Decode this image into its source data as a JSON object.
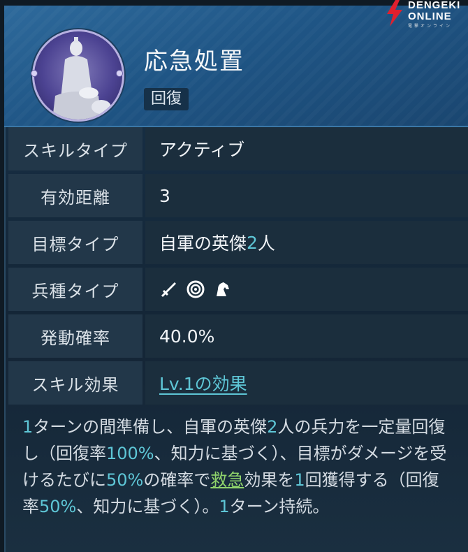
{
  "logo": {
    "text_top": "DENGEKI",
    "text_bottom": "ONLINE",
    "sub": "電撃オンライン"
  },
  "skill": {
    "name": "応急処置",
    "category": "回復"
  },
  "rows": {
    "skill_type": {
      "label": "スキルタイプ",
      "value": "アクティブ"
    },
    "range": {
      "label": "有効距離",
      "value": "3"
    },
    "target": {
      "label": "目標タイプ",
      "value_prefix": "自軍の英傑",
      "value_num": "2",
      "value_suffix": "人"
    },
    "unit_type": {
      "label": "兵種タイプ",
      "icons": [
        "sword-icon",
        "bow-target-icon",
        "cavalry-horse-icon"
      ]
    },
    "trigger_rate": {
      "label": "発動確率",
      "value": "40.0%"
    },
    "skill_effect": {
      "label": "スキル効果",
      "value": "Lv.1の効果"
    }
  },
  "description": {
    "p1": "1",
    "p2": "ターンの間準備し、自軍の英傑",
    "p3": "2",
    "p4": "人の兵力を一定量回復し（回復率",
    "p5": "100%",
    "p6": "、知力に基づく）、目標がダメージを受けるたびに",
    "p7": "50%",
    "p8": "の確率で",
    "p9": "救急",
    "p10": "効果を",
    "p11": "1",
    "p12": "回獲得する（回復率",
    "p13": "50%",
    "p14": "、知力に基づく）。",
    "p15": "1",
    "p16": "ターン持続。"
  },
  "colors": {
    "accent": "#5ec6d6",
    "keyword": "#8fd36b",
    "header": "#1f5585"
  }
}
